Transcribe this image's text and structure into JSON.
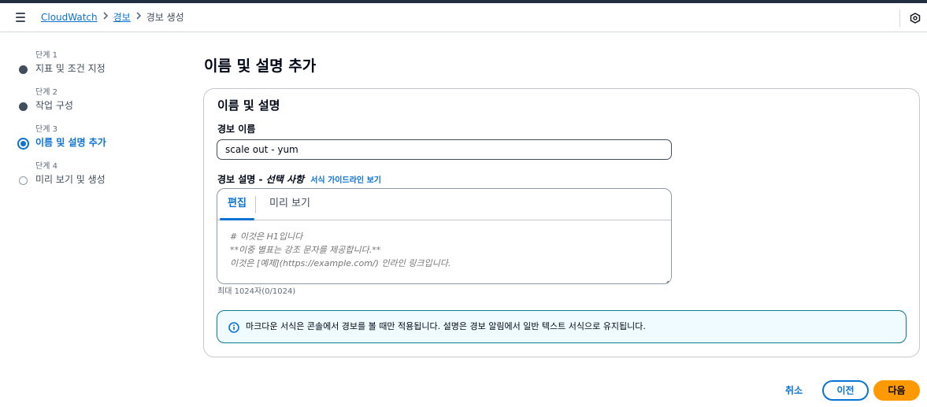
{
  "header": {
    "breadcrumbs": [
      "CloudWatch",
      "경보",
      "경보 생성"
    ]
  },
  "steps": [
    {
      "num": "단계 1",
      "title": "지표 및 조건 지정",
      "state": "complete"
    },
    {
      "num": "단계 2",
      "title": "작업 구성",
      "state": "complete"
    },
    {
      "num": "단계 3",
      "title": "이름 및 설명 추가",
      "state": "active"
    },
    {
      "num": "단계 4",
      "title": "미리 보기 및 생성",
      "state": "pending"
    }
  ],
  "main": {
    "title": "이름 및 설명 추가",
    "container_title": "이름 및 설명",
    "name_label": "경보 이름",
    "name_value": "scale out - yum",
    "desc_label": "경보 설명 - ",
    "desc_optional": "선택 사항",
    "desc_info_link": "서식 가이드라인 보기",
    "tabs": [
      {
        "label": "편집",
        "active": true
      },
      {
        "label": "미리 보기",
        "active": false
      }
    ],
    "desc_placeholder": "# 이것은 H1입니다\n**이중 별표는 강조 문자를 제공합니다.**\n이것은 [예제](https://example.com/) 인라인 링크입니다.",
    "char_count": "최대 1024자(0/1024)",
    "alert_text": "마크다운 서식은 콘솔에서 경보를 볼 때만 적용됩니다. 설명은 경보 알림에서 일반 텍스트 서식으로 유지됩니다."
  },
  "footer": {
    "cancel": "취소",
    "previous": "이전",
    "next": "다음"
  },
  "colors": {
    "link": "#0972d3",
    "primary_button": "#ff9900",
    "info_border": "#0b7b90",
    "info_bg": "#f0fbff"
  }
}
